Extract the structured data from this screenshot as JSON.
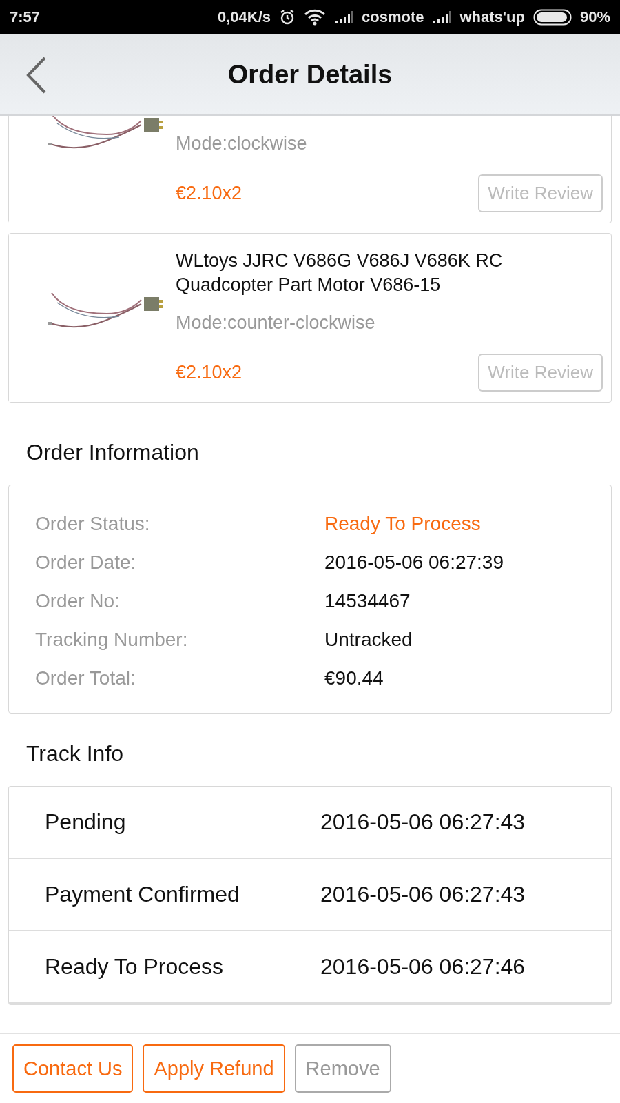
{
  "status_bar": {
    "time": "7:57",
    "speed": "0,04K/s",
    "carriers": [
      "cosmote",
      "whats'up"
    ],
    "battery": "90%"
  },
  "header": {
    "title": "Order Details"
  },
  "products": [
    {
      "mode": "Mode:clockwise",
      "price": "€2.10x2",
      "review_button": {
        "label": "Write Review",
        "disabled": true
      }
    },
    {
      "name": "WLtoys JJRC V686G V686J V686K RC Quadcopter Part Motor V686-15",
      "mode": "Mode:counter-clockwise",
      "price": "€2.10x2",
      "review_button": {
        "label": "Write Review",
        "disabled": true
      }
    }
  ],
  "order_information": {
    "heading": "Order Information",
    "rows": [
      {
        "label": "Order Status:",
        "value": "Ready To Process",
        "kind": "status"
      },
      {
        "label": "Order Date:",
        "value": "2016-05-06 06:27:39",
        "kind": "plain"
      },
      {
        "label": "Order No:",
        "value": "14534467",
        "kind": "plain"
      },
      {
        "label": "Tracking Number:",
        "value": "Untracked",
        "kind": "plain"
      },
      {
        "label": "Order Total:",
        "value": "€90.44",
        "kind": "plain"
      }
    ]
  },
  "track_info": {
    "heading": "Track Info",
    "events": [
      {
        "status": "Pending",
        "time": "2016-05-06 06:27:43"
      },
      {
        "status": "Payment Confirmed",
        "time": "2016-05-06 06:27:43"
      },
      {
        "status": "Ready To Process",
        "time": "2016-05-06 06:27:46"
      }
    ]
  },
  "bottom_bar": {
    "buttons": [
      {
        "label": "Contact Us",
        "disabled": false
      },
      {
        "label": "Apply Refund",
        "disabled": false
      },
      {
        "label": "Remove",
        "disabled": true
      }
    ]
  }
}
